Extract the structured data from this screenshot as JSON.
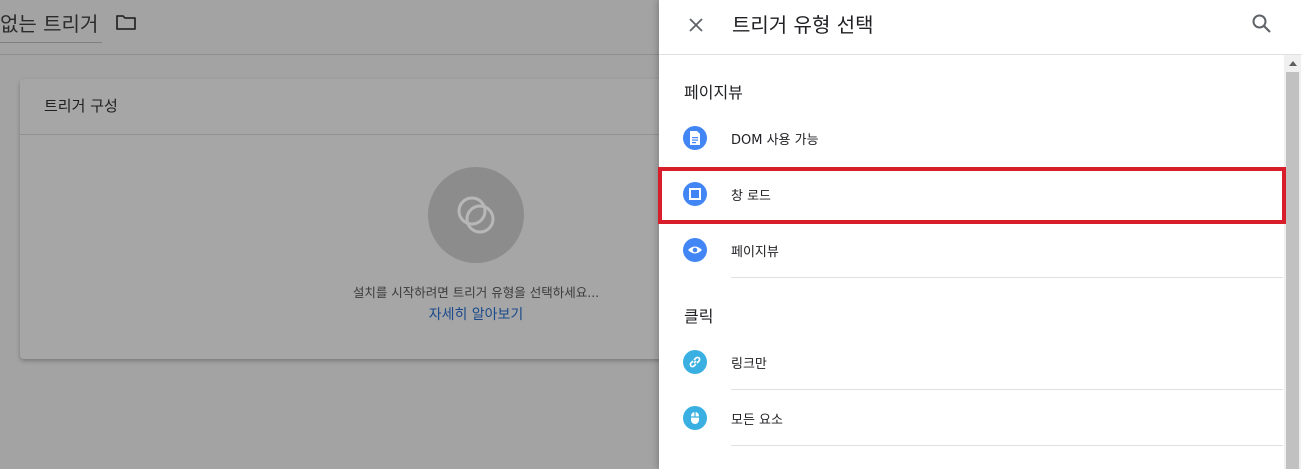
{
  "background": {
    "title": "없는 트리거",
    "folder_icon": "folder-icon",
    "card": {
      "title": "트리거 구성",
      "hint": "설치를 시작하려면 트리거 유형을 선택하세요...",
      "learn_more": "자세히 알아보기"
    }
  },
  "panel": {
    "title": "트리거 유형 선택",
    "close_icon": "close-icon",
    "search_icon": "search-icon",
    "sections": [
      {
        "label": "페이지뷰",
        "items": [
          {
            "label": "DOM 사용 가능",
            "icon": "document-icon"
          },
          {
            "label": "창 로드",
            "icon": "window-icon",
            "highlighted": true
          },
          {
            "label": "페이지뷰",
            "icon": "eye-icon"
          }
        ]
      },
      {
        "label": "클릭",
        "items": [
          {
            "label": "링크만",
            "icon": "link-icon"
          },
          {
            "label": "모든 요소",
            "icon": "mouse-icon"
          }
        ]
      }
    ]
  },
  "colors": {
    "accent_blue": "#4285f4",
    "accent_teal": "#3ab0e2",
    "highlight_red": "#d81e2a"
  }
}
